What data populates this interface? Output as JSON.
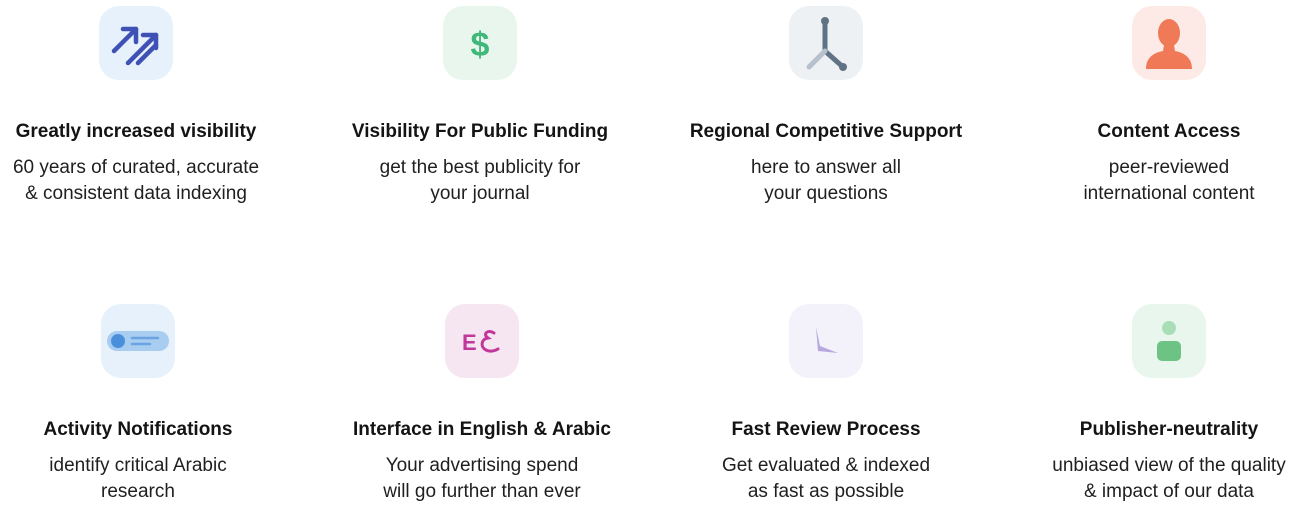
{
  "features": [
    {
      "icon": "trending-arrows-icon",
      "title": "Greatly increased visibility",
      "desc": [
        "60 years of curated, accurate",
        "& consistent data indexing"
      ],
      "tile_color": "#e6f1fb"
    },
    {
      "icon": "dollar-icon",
      "title": "Visibility For Public Funding",
      "desc": [
        "get the best publicity for",
        "your journal"
      ],
      "tile_color": "#e9f6ee"
    },
    {
      "icon": "clock-hands-icon",
      "title": "Regional Competitive Support",
      "desc": [
        "here to answer all",
        "your questions"
      ],
      "tile_color": "#eef1f4"
    },
    {
      "icon": "person-silhouette-icon",
      "title": "Content Access",
      "desc": [
        "peer-reviewed",
        "international content"
      ],
      "tile_color": "#fdeae6"
    },
    {
      "icon": "notification-toggle-icon",
      "title": "Activity Notifications",
      "desc": [
        "identify critical Arabic",
        "research"
      ],
      "tile_color": "#e6f1fb"
    },
    {
      "icon": "language-english-arabic-icon",
      "title": "Interface in English & Arabic",
      "desc": [
        "Your advertising spend",
        "will go further than ever"
      ],
      "tile_color": "#f6e6f2"
    },
    {
      "icon": "fast-review-icon",
      "title": "Fast Review Process",
      "desc": [
        "Get evaluated & indexed",
        "as fast as possible"
      ],
      "tile_color": "#f3f1f9"
    },
    {
      "icon": "user-neutral-icon",
      "title": "Publisher-neutrality",
      "desc": [
        "unbiased view of the quality",
        "& impact of our data"
      ],
      "tile_color": "#e9f6ee"
    }
  ],
  "colors": {
    "arrows": "#3f51b5",
    "dollar": "#3fb87a",
    "clock_dark": "#5f7384",
    "clock_light": "#b6c1cb",
    "person": "#f07a57",
    "toggle_bar": "#a9cdf0",
    "toggle_dot": "#4a8fdc",
    "arabic": "#c0399a",
    "review": "#b7a9dd",
    "user_head": "#a9ddb6",
    "user_body": "#6cc383"
  }
}
